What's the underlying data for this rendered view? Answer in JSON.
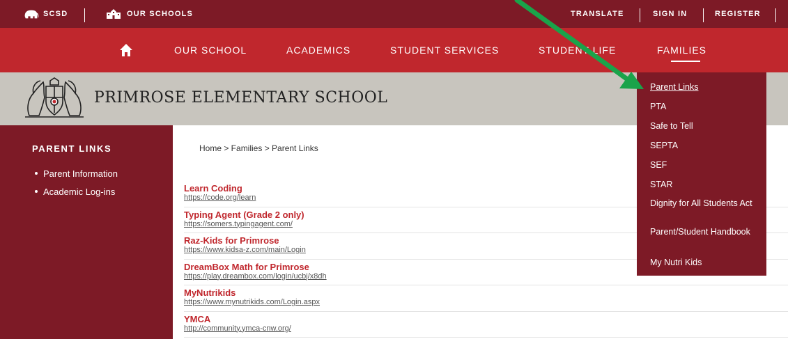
{
  "topbar": {
    "brand_label": "SCSD",
    "schools_label": "OUR SCHOOLS",
    "translate_label": "TRANSLATE",
    "signin_label": "SIGN IN",
    "register_label": "REGISTER"
  },
  "nav": {
    "items": [
      "OUR SCHOOL",
      "ACADEMICS",
      "STUDENT SERVICES",
      "STUDENT LIFE",
      "FAMILIES"
    ],
    "active": "FAMILIES"
  },
  "school": {
    "name": "PRIMROSE ELEMENTARY SCHOOL"
  },
  "sidebar": {
    "title": "PARENT LINKS",
    "items": [
      "Parent Information",
      "Academic Log-ins"
    ]
  },
  "breadcrumb": "Home > Families > Parent Links",
  "links": [
    {
      "title": "Learn Coding",
      "url": "https://code.org/learn"
    },
    {
      "title": "Typing Agent (Grade 2 only)",
      "url": "https://somers.typingagent.com/"
    },
    {
      "title": "Raz-Kids for Primrose",
      "url": "https://www.kidsa-z.com/main/Login"
    },
    {
      "title": "DreamBox Math for Primrose",
      "url": "https://play.dreambox.com/login/ucbj/x8dh"
    },
    {
      "title": "MyNutrikids",
      "url": "https://www.mynutrikids.com/Login.aspx"
    },
    {
      "title": "YMCA",
      "url": "http://community.ymca-cnw.org/"
    }
  ],
  "dropdown": {
    "items": [
      "Parent Links",
      "PTA",
      "Safe to Tell",
      "SEPTA",
      "SEF",
      "STAR",
      "Dignity for All Students Act",
      "Parent/Student Handbook",
      "My Nutri Kids"
    ],
    "active": "Parent Links"
  },
  "colors": {
    "topbar": "#7d1a26",
    "nav": "#c0272d",
    "band": "#c8c5be",
    "link": "#c0272d",
    "arrow": "#1aa34a"
  },
  "icons": {
    "brand": "elephant-icon",
    "schools": "schoolhouse-icon",
    "home": "home-icon",
    "crest": "school-crest-logo",
    "annotation": "green-arrow"
  }
}
